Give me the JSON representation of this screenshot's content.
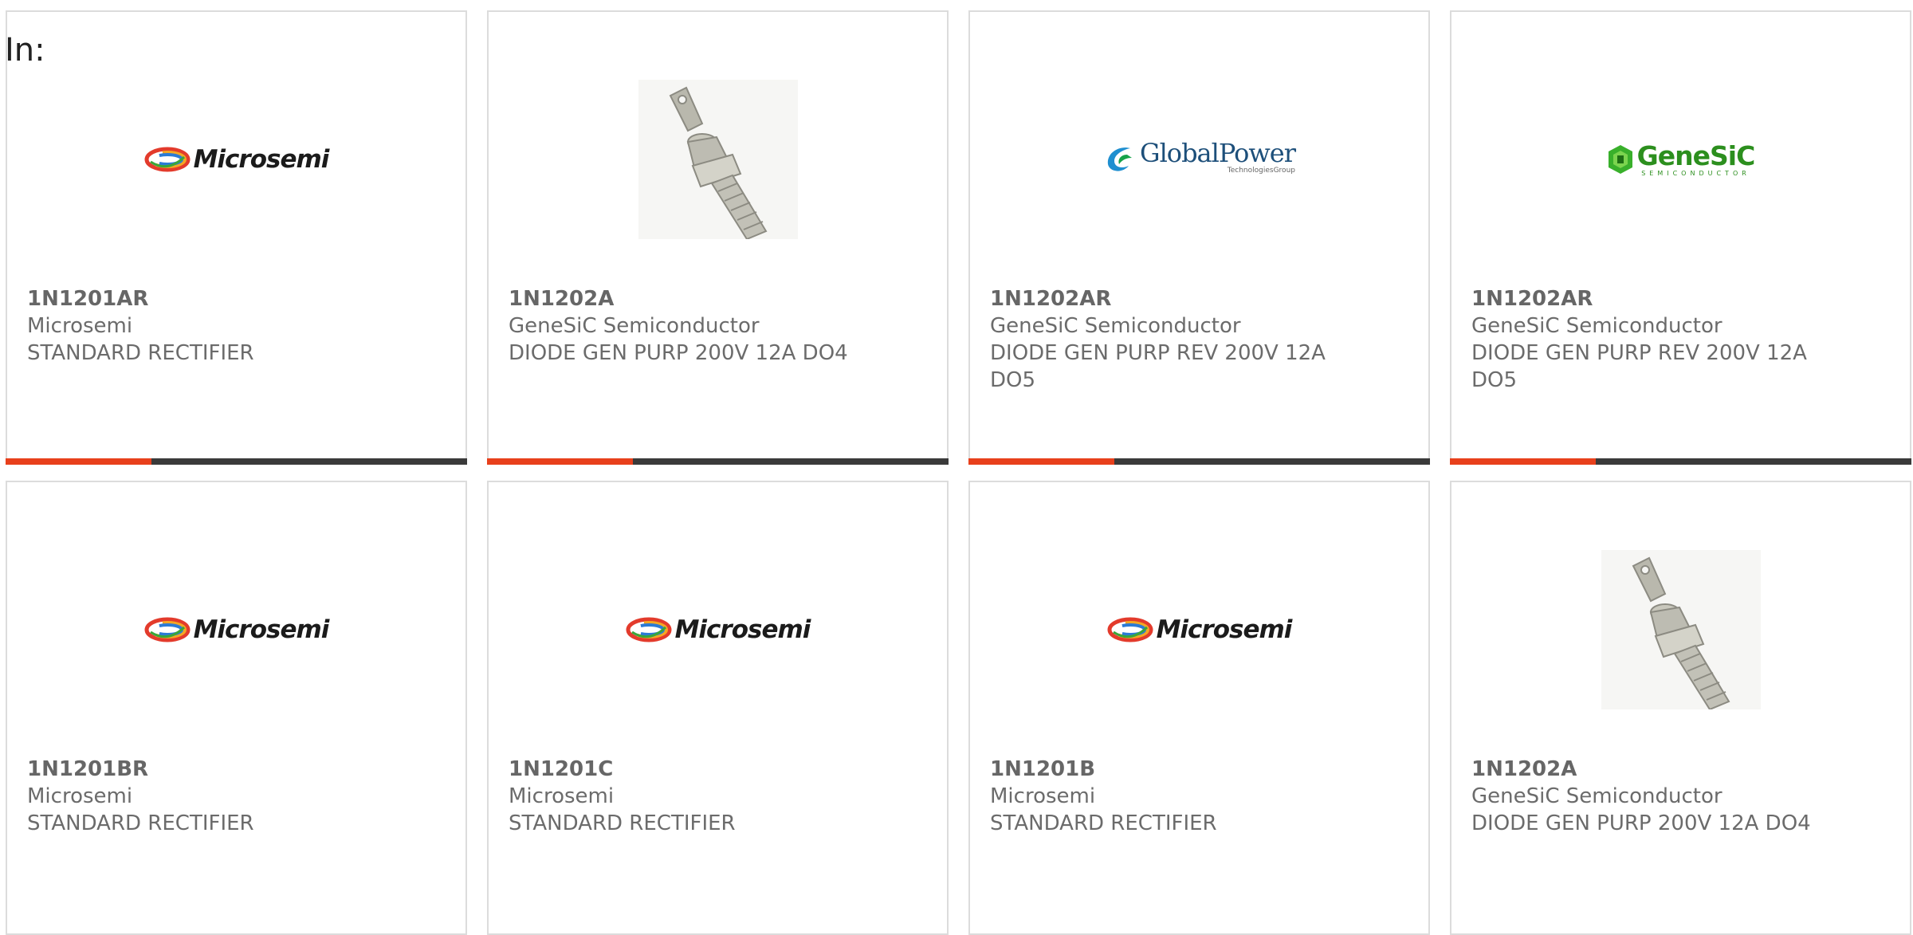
{
  "header": {
    "label": "In:"
  },
  "colors": {
    "accent": "#e8401c",
    "bar_dark": "#3a3a3a",
    "border": "#dcdcdc",
    "text": "#6b6b6b"
  },
  "cards": [
    {
      "part_number": "1N1201AR",
      "manufacturer": "Microsemi",
      "description": "STANDARD RECTIFIER",
      "image": "microsemi-logo",
      "logo_text": "Microsemi"
    },
    {
      "part_number": "1N1202A",
      "manufacturer": "GeneSiC Semiconductor",
      "description": "DIODE GEN PURP 200V 12A DO4",
      "image": "stud-diode-photo"
    },
    {
      "part_number": "1N1202AR",
      "manufacturer": "GeneSiC Semiconductor",
      "description": "DIODE GEN PURP REV 200V 12A DO5",
      "image": "globalpower-logo",
      "logo_text": "GlobalPower",
      "logo_sub": "TechnologiesGroup"
    },
    {
      "part_number": "1N1202AR",
      "manufacturer": "GeneSiC Semiconductor",
      "description": "DIODE GEN PURP REV 200V 12A DO5",
      "image": "genesic-logo",
      "logo_text": "GeneSiC",
      "logo_sub": "SEMICONDUCTOR"
    },
    {
      "part_number": "1N1201BR",
      "manufacturer": "Microsemi",
      "description": "STANDARD RECTIFIER",
      "image": "microsemi-logo",
      "logo_text": "Microsemi"
    },
    {
      "part_number": "1N1201C",
      "manufacturer": "Microsemi",
      "description": "STANDARD RECTIFIER",
      "image": "microsemi-logo",
      "logo_text": "Microsemi"
    },
    {
      "part_number": "1N1201B",
      "manufacturer": "Microsemi",
      "description": "STANDARD RECTIFIER",
      "image": "microsemi-logo",
      "logo_text": "Microsemi"
    },
    {
      "part_number": "1N1202A",
      "manufacturer": "GeneSiC Semiconductor",
      "description": "DIODE GEN PURP 200V 12A DO4",
      "image": "stud-diode-photo"
    }
  ]
}
